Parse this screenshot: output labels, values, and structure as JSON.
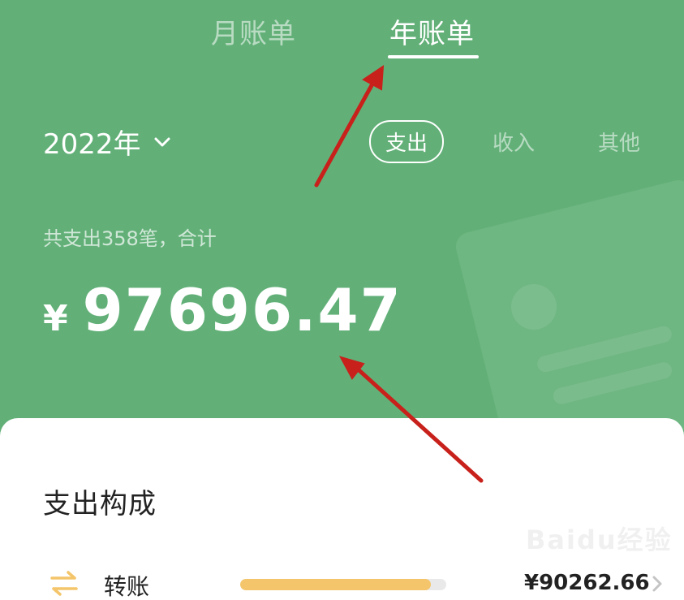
{
  "tabs": [
    {
      "label": "月账单",
      "active": false
    },
    {
      "label": "年账单",
      "active": true
    }
  ],
  "year_selector": {
    "value": "2022年"
  },
  "type_filters": [
    {
      "label": "支出",
      "active": true
    },
    {
      "label": "收入",
      "active": false
    },
    {
      "label": "其他",
      "active": false
    }
  ],
  "summary": {
    "text": "共支出358笔，合计",
    "currency": "¥",
    "amount": "97696.47"
  },
  "panel": {
    "title": "支出构成",
    "rows": [
      {
        "icon": "transfer-arrows-icon",
        "label": "转账",
        "amount": "¥90262.66",
        "ratio": 0.924
      }
    ]
  },
  "watermark": "Baidu经验",
  "colors": {
    "header_bg": "#62b078",
    "bar_fill": "#f4c56a",
    "annotation_arrow": "#c8211b"
  }
}
